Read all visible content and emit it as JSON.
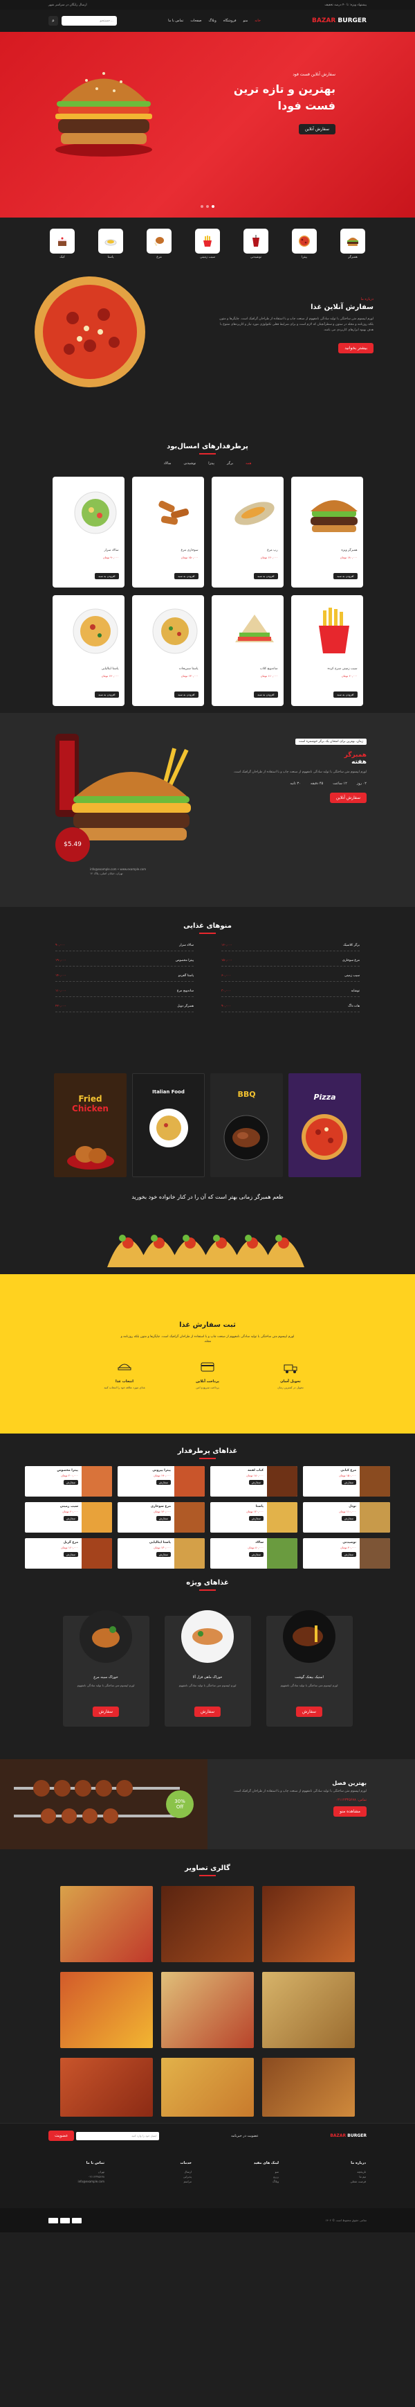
{
  "topbar": {
    "right": "پیشنهاد ویژه: تا ۴۰ درصد تخفیف",
    "left": "ارسال رایگان در سراسر شهر"
  },
  "header": {
    "logo_a": "BAZAR",
    "logo_b": "BURGER",
    "nav": [
      "خانه",
      "منو",
      "فروشگاه",
      "وبلاگ",
      "صفحات",
      "تماس با ما"
    ],
    "search_placeholder": "جستجو..."
  },
  "hero": {
    "kicker": "سفارش آنلاین فست فود",
    "title_line1": "بهترین و تازه ترین",
    "title_line2": "فست فودا",
    "cta": "سفارش آنلاین"
  },
  "categories": [
    "همبرگر",
    "پیتزا",
    "نوشیدنی",
    "سیب زمینی",
    "مرغ",
    "پاستا",
    "کیک"
  ],
  "about": {
    "kicker": "درباره ما",
    "title": "سفارش آنلاین غذا",
    "text": "لورم ایپسوم متن ساختگی با تولید سادگی نامفهوم از صنعت چاپ و با استفاده از طراحان گرافیک است. چاپگرها و متون بلکه روزنامه و مجله در ستون و سطرآنچنان که لازم است و برای شرایط فعلی تکنولوژی مورد نیاز و کاربردهای متنوع با هدف بهبود ابزارهای کاربردی می باشد.",
    "cta": "بیشتر بخوانید"
  },
  "menu": {
    "title": "پرطرفدارهای امسال‌بود",
    "tabs": [
      "همه",
      "برگر",
      "پیتزا",
      "نوشیدنی",
      "سالاد"
    ],
    "items": [
      {
        "name": "همبرگر ویژه",
        "price": "۱۸۰,۰۰۰ تومان",
        "add": "افزودن به سبد"
      },
      {
        "name": "رپ مرغ",
        "price": "۱۲۰,۰۰۰ تومان",
        "add": "افزودن به سبد"
      },
      {
        "name": "سوخاری مرغ",
        "price": "۱۵۰,۰۰۰ تومان",
        "add": "افزودن به سبد"
      },
      {
        "name": "سالاد سزار",
        "price": "۹۰,۰۰۰ تومان",
        "add": "افزودن به سبد"
      },
      {
        "name": "سیب زمینی سرخ کرده",
        "price": "۶۰,۰۰۰ تومان",
        "add": "افزودن به سبد"
      },
      {
        "name": "ساندویچ کلاب",
        "price": "۱۱۰,۰۰۰ تومان",
        "add": "افزودن به سبد"
      },
      {
        "name": "پاستا سبزیجات",
        "price": "۱۳۰,۰۰۰ تومان",
        "add": "افزودن به سبد"
      },
      {
        "name": "پاستا ایتالیایی",
        "price": "۱۴۰,۰۰۰ تومان",
        "add": "افزودن به سبد"
      }
    ]
  },
  "promo": {
    "tag": "زمان، بهترین برای امتحان یک برگر خوشمزه است",
    "title_1": "همبرگر",
    "title_2": "هفته",
    "text": "لورم ایپسوم متن ساختگی با تولید سادگی نامفهوم از صنعت چاپ و با استفاده از طراحان گرافیک است.",
    "countdown": [
      "۰۲ روز",
      "۱۲ ساعت",
      "۴۵ دقیقه",
      "۳۰ ثانیه"
    ],
    "cta": "سفارش آنلاین",
    "price": "$5.49",
    "contact_1": "info@example.com • www.example.com",
    "contact_2": "تهران، خیابان اصلی، پلاک ۱۲"
  },
  "pricelist": {
    "title": "منوهای غذایی",
    "left": [
      {
        "name": "سالاد سزار",
        "price": "۹۰,۰۰۰"
      },
      {
        "name": "پیتزا مخصوص",
        "price": "۱۹۰,۰۰۰"
      },
      {
        "name": "پاستا آلفردو",
        "price": "۱۴۰,۰۰۰"
      },
      {
        "name": "ساندویچ مرغ",
        "price": "۱۱۰,۰۰۰"
      },
      {
        "name": "همبرگر دوبل",
        "price": "۲۲۰,۰۰۰"
      }
    ],
    "right": [
      {
        "name": "برگر کلاسیک",
        "price": "۱۶۰,۰۰۰"
      },
      {
        "name": "مرغ سوخاری",
        "price": "۱۵۰,۰۰۰"
      },
      {
        "name": "سیب زمینی",
        "price": "۶۰,۰۰۰"
      },
      {
        "name": "نوشابه",
        "price": "۳۰,۰۰۰"
      },
      {
        "name": "هات داگ",
        "price": "۹۰,۰۰۰"
      }
    ]
  },
  "banners": {
    "b1_line1": "Fried",
    "b1_line2": "Chicken",
    "b2": "Italian Food",
    "b3": "BBQ",
    "b4": "Pizza"
  },
  "tacos": {
    "title": "طعم همبرگر زمانی بهتر است که آن را در کنار خانواده خود بخورید"
  },
  "order": {
    "title": "ثبت سفارش غذا",
    "lead": "لورم ایپسوم متن ساختگی با تولید سادگی نامفهوم از صنعت چاپ و با استفاده از طراحان گرافیک است. چاپگرها و متون بلکه روزنامه و مجله.",
    "steps": [
      {
        "t": "انتخاب غذا",
        "d": "غذای مورد علاقه خود را انتخاب کنید"
      },
      {
        "t": "پرداخت آنلاین",
        "d": "پرداخت سریع و امن"
      },
      {
        "t": "تحویل آسان",
        "d": "تحویل در کمترین زمان"
      }
    ]
  },
  "popular": {
    "title": "غذاهای پرطرفدار",
    "items": [
      {
        "name": "مرغ کبابی",
        "price": "۱۵۰,۰۰۰ تومان",
        "add": "سفارش"
      },
      {
        "name": "کباب لقمه",
        "price": "۱۸۰,۰۰۰ تومان",
        "add": "سفارش"
      },
      {
        "name": "پیتزا پپرونی",
        "price": "۱۹۰,۰۰۰ تومان",
        "add": "سفارش"
      },
      {
        "name": "پیتزا مخصوص",
        "price": "۲۰۰,۰۰۰ تومان",
        "add": "سفارش"
      },
      {
        "name": "نودل",
        "price": "۱۱۰,۰۰۰ تومان",
        "add": "سفارش"
      },
      {
        "name": "پاستا",
        "price": "۱۲۰,۰۰۰ تومان",
        "add": "سفارش"
      },
      {
        "name": "مرغ سوخاری",
        "price": "۱۴۰,۰۰۰ تومان",
        "add": "سفارش"
      },
      {
        "name": "سیب زمینی",
        "price": "۶۰,۰۰۰ تومان",
        "add": "سفارش"
      },
      {
        "name": "نوشیدنی",
        "price": "۴۰,۰۰۰ تومان",
        "add": "سفارش"
      },
      {
        "name": "سالاد",
        "price": "۸۰,۰۰۰ تومان",
        "add": "سفارش"
      },
      {
        "name": "پاستا ایتالیایی",
        "price": "۱۳۰,۰۰۰ تومان",
        "add": "سفارش"
      },
      {
        "name": "مرغ گریل",
        "price": "۱۶۰,۰۰۰ تومان",
        "add": "سفارش"
      }
    ]
  },
  "special": {
    "title": "غذاهای ویژه",
    "items": [
      {
        "name": "استیک بیفتک گوشت",
        "desc": "لورم ایپسوم متن ساختگی با تولید سادگی نامفهوم",
        "cta": "سفارش"
      },
      {
        "name": "خوراک ماهی قزل آلا",
        "desc": "لورم ایپسوم متن ساختگی با تولید سادگی نامفهوم",
        "cta": "سفارش"
      },
      {
        "name": "خوراک سینه مرغ",
        "desc": "لورم ایپسوم متن ساختگی با تولید سادگی نامفهوم",
        "cta": "سفارش"
      }
    ]
  },
  "kebab": {
    "title": "بهترین فصل",
    "text": "لورم ایپسوم متن ساختگی با تولید سادگی نامفهوم از صنعت چاپ و با استفاده از طراحان گرافیک است.",
    "phone": "تماس: ۰۲۱۱۲۳۴۵۶۷۸",
    "cta": "مشاهده منو",
    "badge_1": "30%",
    "badge_2": "Off"
  },
  "gallery": {
    "title": "گالری تصاویر"
  },
  "newsletter": {
    "logo_a": "BAZAR",
    "logo_b": "BURGER",
    "label": "عضویت در خبرنامه",
    "placeholder": "ایمیل خود را وارد کنید",
    "cta": "عضویت"
  },
  "footer": {
    "cols": [
      {
        "h": "درباره ما",
        "l": [
          "تاریخچه",
          "تیم ما",
          "فرصت شغلی"
        ]
      },
      {
        "h": "لینک های مفید",
        "l": [
          "منو",
          "رزرو",
          "وبلاگ"
        ]
      },
      {
        "h": "خدمات",
        "l": [
          "ارسال",
          "پذیرایی",
          "مراسم"
        ]
      },
      {
        "h": "تماس با ما",
        "l": [
          "تهران",
          "۰۲۱۱۲۳۴۵۶۷۸",
          "info@example.com"
        ]
      }
    ],
    "copyright": "تمامی حقوق محفوظ است © ۱۴۰۲"
  }
}
